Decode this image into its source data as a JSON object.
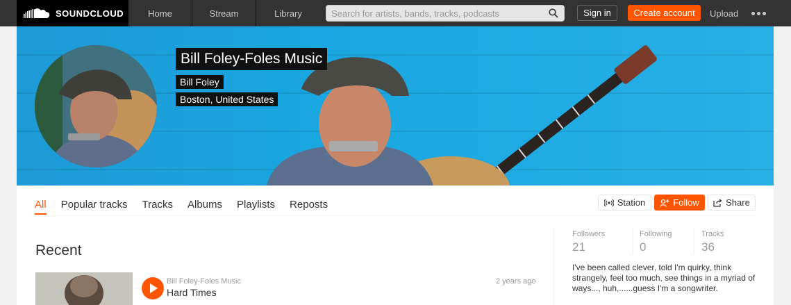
{
  "header": {
    "brand": "SOUNDCLOUD",
    "nav": [
      {
        "label": "Home"
      },
      {
        "label": "Stream"
      },
      {
        "label": "Library"
      }
    ],
    "search": {
      "placeholder": "Search for artists, bands, tracks, podcasts",
      "value": ""
    },
    "sign_in_label": "Sign in",
    "create_account_label": "Create account",
    "upload_label": "Upload",
    "icons": {
      "more": "more-dots-icon",
      "search": "search-icon"
    }
  },
  "profile": {
    "display_name": "Bill Foley-Foles Music",
    "real_name": "Bill Foley",
    "location": "Boston, United States"
  },
  "tabs": [
    {
      "label": "All",
      "active": true
    },
    {
      "label": "Popular tracks"
    },
    {
      "label": "Tracks"
    },
    {
      "label": "Albums"
    },
    {
      "label": "Playlists"
    },
    {
      "label": "Reposts"
    }
  ],
  "actions": {
    "station_label": "Station",
    "follow_label": "Follow",
    "share_label": "Share"
  },
  "recent": {
    "heading": "Recent",
    "track": {
      "artist": "Bill Foley-Foles Music",
      "title": "Hard Times",
      "age": "2 years ago"
    }
  },
  "stats": [
    {
      "label": "Followers",
      "value": "21"
    },
    {
      "label": "Following",
      "value": "0"
    },
    {
      "label": "Tracks",
      "value": "36"
    }
  ],
  "bio": "I've been called clever, told I'm quirky, think strangely, feel too much, see things in a myriad of ways..., huh,......guess I'm a songwriter.",
  "colors": {
    "accent": "#ff5500",
    "topbar": "#333333",
    "banner": "#1aa6e0"
  }
}
